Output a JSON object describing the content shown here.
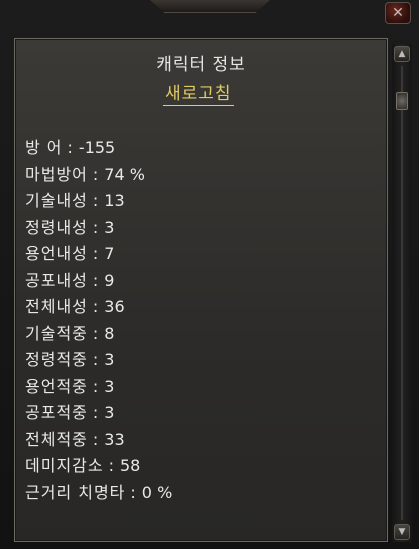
{
  "window": {
    "close_glyph": "✕"
  },
  "panel": {
    "title": "캐릭터 정보",
    "refresh_label": "새로고침"
  },
  "stats": [
    {
      "label": "방 어",
      "sep": ":",
      "value": "-155"
    },
    {
      "label": "마법방어",
      "sep": ":",
      "value": "74 %"
    },
    {
      "label": "기술내성",
      "sep": ":",
      "value": "13"
    },
    {
      "label": "정령내성",
      "sep": ":",
      "value": "3"
    },
    {
      "label": "용언내성",
      "sep": ":",
      "value": "7"
    },
    {
      "label": "공포내성",
      "sep": ":",
      "value": "9"
    },
    {
      "label": "전체내성",
      "sep": ":",
      "value": "36"
    },
    {
      "label": "기술적중",
      "sep": ":",
      "value": "8"
    },
    {
      "label": "정령적중",
      "sep": ":",
      "value": "3"
    },
    {
      "label": "용언적중",
      "sep": ":",
      "value": "3"
    },
    {
      "label": "공포적중",
      "sep": ":",
      "value": "3"
    },
    {
      "label": "전체적중",
      "sep": ":",
      "value": "33"
    },
    {
      "label": "데미지감소",
      "sep": ":",
      "value": "58"
    },
    {
      "label": "근거리 치명타",
      "sep": ":",
      "value": "0 %"
    }
  ],
  "scrollbar": {
    "up_glyph": "▲",
    "down_glyph": "▼"
  },
  "colors": {
    "title_text": "#e6e6e6",
    "refresh_link": "#e3cb63",
    "stat_text": "#e8e8e8",
    "panel_border": "#6d6a63"
  }
}
